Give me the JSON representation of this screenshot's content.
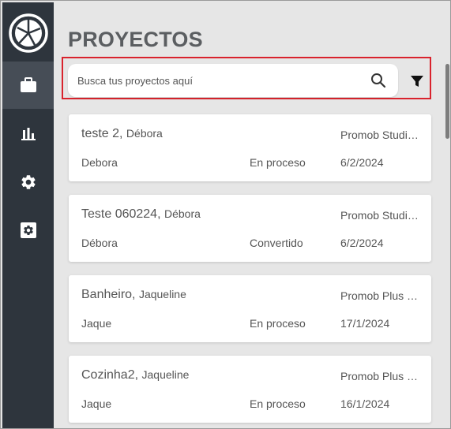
{
  "page": {
    "title": "PROYECTOS"
  },
  "search": {
    "placeholder": "Busca tus proyectos aquí",
    "value": ""
  },
  "sidebar": {
    "items": [
      {
        "name": "projects",
        "icon": "briefcase-icon",
        "active": true
      },
      {
        "name": "reports",
        "icon": "bar-chart-icon",
        "active": false
      },
      {
        "name": "settings",
        "icon": "gear-icon",
        "active": false
      },
      {
        "name": "admin-settings",
        "icon": "settings-box-icon",
        "active": false
      }
    ]
  },
  "projects": [
    {
      "name": "teste 2",
      "client": "Débora",
      "product": "Promob Studi…",
      "user": "Debora",
      "status": "En proceso",
      "date": "6/2/2024"
    },
    {
      "name": "Teste 060224",
      "client": "Débora",
      "product": "Promob Studi…",
      "user": "Débora",
      "status": "Convertido",
      "date": "6/2/2024"
    },
    {
      "name": "Banheiro",
      "client": "Jaqueline",
      "product": "Promob Plus …",
      "user": "Jaque",
      "status": "En proceso",
      "date": "17/1/2024"
    },
    {
      "name": "Cozinha2",
      "client": "Jaqueline",
      "product": "Promob Plus …",
      "user": "Jaque",
      "status": "En proceso",
      "date": "16/1/2024"
    }
  ],
  "colors": {
    "sidebar": "#2e353d",
    "sidebar_active": "#464d56",
    "background": "#e6e6e6",
    "highlight": "#d9232d",
    "text": "#555555"
  }
}
